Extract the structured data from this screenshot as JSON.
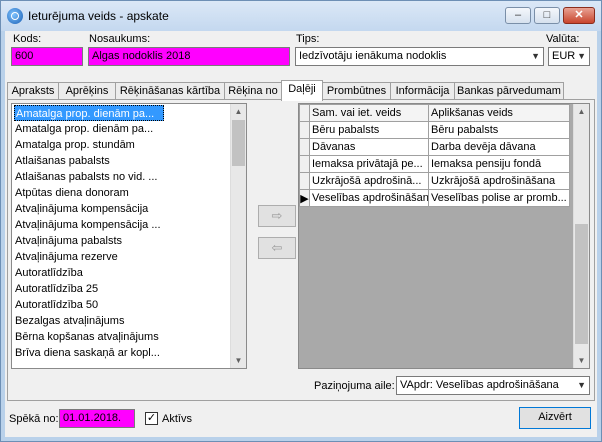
{
  "window": {
    "title": "Ieturējuma veids - apskate",
    "minimize_glyph": "–",
    "maximize_glyph": "□",
    "close_glyph": "✕"
  },
  "header": {
    "kods_label": "Kods:",
    "kods_value": "600",
    "nosaukums_label": "Nosaukums:",
    "nosaukums_value": "Algas nodoklis 2018",
    "tips_label": "Tips:",
    "tips_value": "Iedzīvotāju ienākuma nodoklis",
    "valuta_label": "Valūta:",
    "valuta_value": "EUR"
  },
  "tabs": [
    {
      "label": "Apraksts"
    },
    {
      "label": "Aprēķins"
    },
    {
      "label": "Rēķināšanas kārtība"
    },
    {
      "label": "Rēķina no"
    },
    {
      "label": "Daļēji"
    },
    {
      "label": "Prombūtnes"
    },
    {
      "label": "Informācija"
    },
    {
      "label": "Bankas pārvedumam"
    }
  ],
  "available_list": [
    "Amatalga prop. dienām pa...",
    "Amatalga prop. dienām pa...",
    "Amatalga prop. stundām",
    "Atlaišanas pabalsts",
    "Atlaišanas pabalsts no vid. ...",
    "Atpūtas diena donoram",
    "Atvaļinājuma kompensācija",
    "Atvaļinājuma kompensācija ...",
    "Atvaļinājuma pabalsts",
    "Atvaļinājuma rezerve",
    "Autoratlīdzība",
    "Autoratlīdzība 25",
    "Autoratlīdzība 50",
    "Bezalgas atvaļinājums",
    "Bērna kopšanas atvaļinājums",
    "Brīva diena saskaņā ar kopl..."
  ],
  "move_buttons": {
    "add": "⇨",
    "remove": "⇦"
  },
  "grid": {
    "headers": [
      "Sam. vai iet. veids",
      "Aplikšanas veids"
    ],
    "rows": [
      [
        "Bēru pabalsts",
        "Bēru pabalsts"
      ],
      [
        "Dāvanas",
        "Darba devēja dāvana"
      ],
      [
        "Iemaksa privātajā pe...",
        "Iemaksa pensiju fondā"
      ],
      [
        "Uzkrājošā apdrošinā...",
        "Uzkrājošā apdrošināšana"
      ],
      [
        "Veselības apdrošināšana",
        "Veselības polise ar promb..."
      ]
    ],
    "current_indicator": "▶"
  },
  "footer": {
    "pazinojuma_label": "Paziņojuma aile:",
    "pazinojuma_value": "VApdr: Veselības apdrošināšana",
    "speka_label": "Spēkā no:",
    "speka_value": "01.01.2018.",
    "aktivs_label": "Aktīvs",
    "aktivs_mark": "✓",
    "close_label": "Aizvērt"
  },
  "colors": {
    "highlight": "#ff00ff",
    "selection": "#3399ff"
  }
}
